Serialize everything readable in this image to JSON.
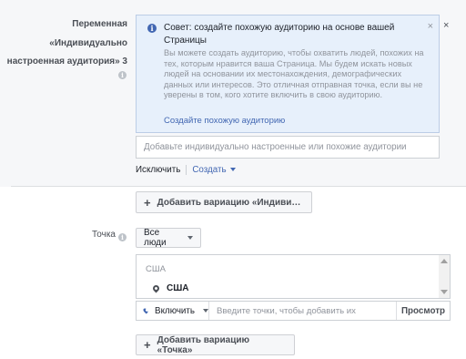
{
  "variable": {
    "label_lines": [
      "Переменная",
      "«Индивидуально",
      "настроенная аудитория» 3"
    ]
  },
  "tip": {
    "title": "Совет: создайте похожую аудиторию на основе вашей Страницы",
    "body": "Вы можете создать аудиторию, чтобы охватить людей, похожих на тех, которым нравится ваша Страница. Мы будем искать новых людей на основании их местонахождения, демографических данных или интересов. Это отличная отправная точка, если вы не уверены в том, кого хотите включить в свою аудиторию.",
    "link": "Создайте похожую аудиторию",
    "close": "×"
  },
  "outer_close": "×",
  "audience_input": {
    "placeholder": "Добавьте индивидуально настроенные или похожие аудитории"
  },
  "links": {
    "exclude": "Исключить",
    "create": "Создать"
  },
  "add_variation_custom": {
    "label": "Добавить вариацию «Индиви…"
  },
  "location": {
    "label": "Точка",
    "dropdown": "Все люди",
    "group": "США",
    "item": "США",
    "include": "Включить",
    "search_placeholder": "Введите точки, чтобы добавить их",
    "browse": "Просмотр"
  },
  "add_variation_location": {
    "label": "Добавить вариацию «Точка»"
  },
  "colors": {
    "accent": "#4267b2",
    "tip_bg": "#e7f0fb",
    "band_bg": "#f6f7f9"
  },
  "icons": [
    "info-icon",
    "close-icon",
    "location-pin-icon",
    "caret-down-icon",
    "plus-icon",
    "scroll-up-icon",
    "scroll-down-icon"
  ]
}
